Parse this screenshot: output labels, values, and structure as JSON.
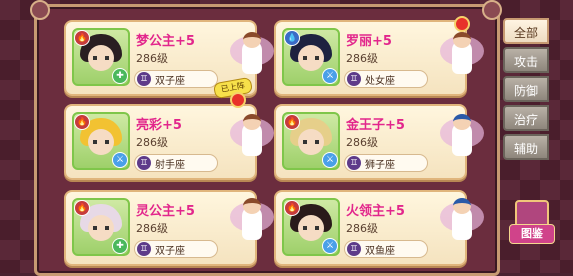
{
  "tabs": [
    {
      "label": "全部",
      "active": true
    },
    {
      "label": "攻击",
      "active": false
    },
    {
      "label": "防御",
      "active": false
    },
    {
      "label": "治疗",
      "active": false
    },
    {
      "label": "辅助",
      "active": false
    }
  ],
  "cards": [
    {
      "name": "梦公主+5",
      "level": "286级",
      "sign": "双子座",
      "element": "fire",
      "role": "heal",
      "hair": "#2a1e22",
      "fairy": "pink"
    },
    {
      "name": "罗丽+5",
      "level": "286级",
      "sign": "处女座",
      "element": "water",
      "role": "attack",
      "hair": "#1e2240",
      "fairy": "pink"
    },
    {
      "name": "亮彩+5",
      "level": "286级",
      "sign": "射手座",
      "element": "fire",
      "role": "attack",
      "hair": "#f2c232",
      "fairy": "pink"
    },
    {
      "name": "金王子+5",
      "level": "286级",
      "sign": "狮子座",
      "element": "fire",
      "role": "attack",
      "hair": "#e6cf8a",
      "fairy": "blue"
    },
    {
      "name": "灵公主+5",
      "level": "286级",
      "sign": "双子座",
      "element": "fire",
      "role": "heal",
      "hair": "#e7d9e6",
      "fairy": "pink"
    },
    {
      "name": "火领主+5",
      "level": "286级",
      "sign": "双鱼座",
      "element": "fire",
      "role": "attack",
      "hair": "#2a1a1a",
      "fairy": "blue"
    }
  ],
  "on_stage_label": "已上阵",
  "tujian_label": "图鉴",
  "colors": {
    "name": "#e2268c",
    "frame": "#c79a72",
    "tab_active": "#fff4e2"
  }
}
